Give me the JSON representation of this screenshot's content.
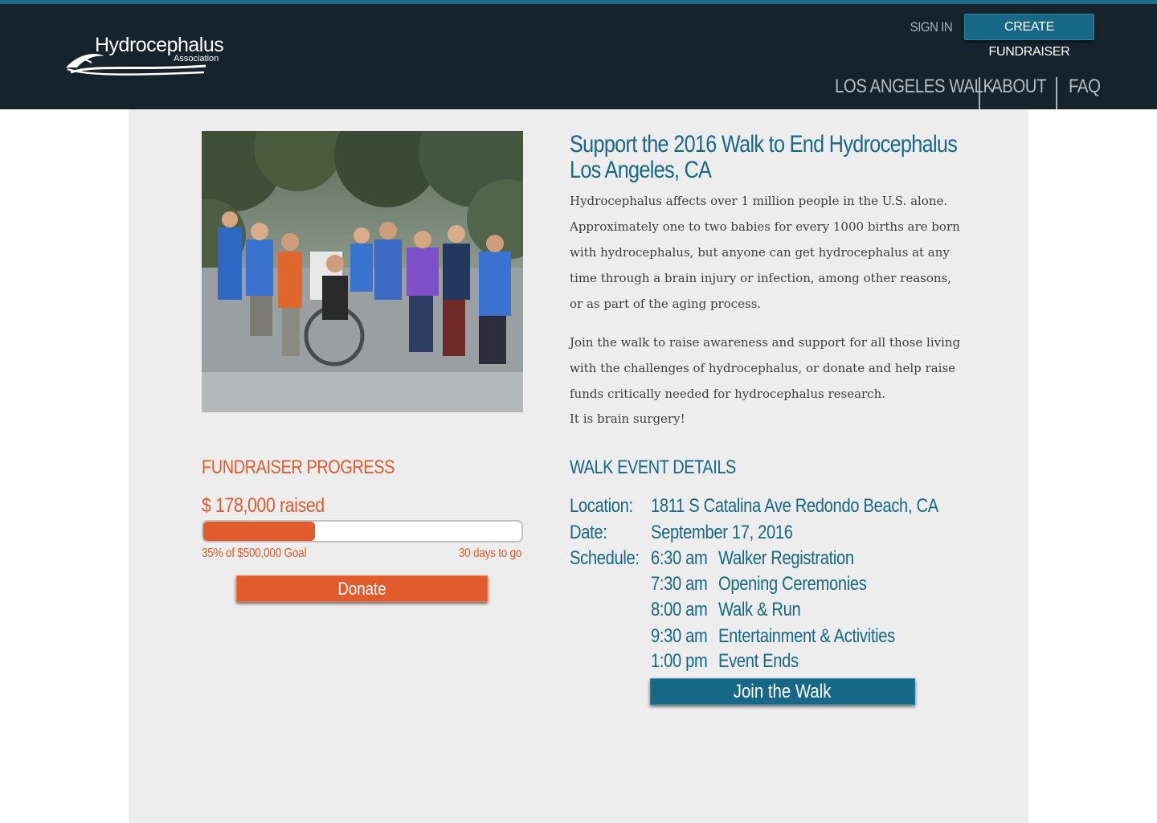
{
  "header": {
    "logo_name": "Hydrocephalus",
    "logo_sub": "Association",
    "sign_in_label": "SIGN IN",
    "create_fundraiser_label": "CREATE FUNDRAISER",
    "nav": [
      {
        "label": "LOS ANGELES WALK"
      },
      {
        "label": "ABOUT"
      },
      {
        "label": "FAQ"
      }
    ],
    "colors": {
      "bar": "#16222c",
      "accent": "#1d6c8c"
    }
  },
  "intro": {
    "headline_lines": [
      "Support the 2016 Walk to End Hydrocephalus",
      "Los Angeles, CA"
    ],
    "paragraph1_lines": [
      "Hydrocephalus affects over 1 million people in the U.S. alone.",
      "Approximately one to two babies for every 1000 births are born",
      "with hydrocephalus, but anyone can get hydrocephalus at any",
      "time through a brain injury or infection, among other reasons,",
      "or as part of the aging process."
    ],
    "paragraph2_lines": [
      "Join the walk to raise awareness and support for all those living",
      "with the challenges of hydrocephalus, or donate and help raise",
      "funds critically needed for hydrocephalus research.",
      "It is brain surgery!"
    ]
  },
  "progress": {
    "heading": "FUNDRAISER PROGRESS",
    "raised_text": "$ 178,000 raised",
    "percent": 35,
    "goal_text": "35% of $500,000 Goal",
    "days_text": "30 days to go",
    "donate_label": "Donate",
    "color": "#e15b2d"
  },
  "event": {
    "heading": "WALK EVENT DETAILS",
    "location_label": "Location:",
    "location_value": "1811 S Catalina Ave Redondo Beach, CA",
    "date_label": "Date:",
    "date_value": "September 17, 2016",
    "schedule_label": "Schedule:",
    "schedule": [
      {
        "time": "6:30 am",
        "activity": "Walker Registration"
      },
      {
        "time": "7:30 am",
        "activity": "Opening Ceremonies"
      },
      {
        "time": "8:00 am",
        "activity": "Walk & Run"
      },
      {
        "time": "9:30 am",
        "activity": "Entertainment & Activities"
      },
      {
        "time": "1:00 pm",
        "activity": "Event Ends"
      }
    ],
    "join_label": "Join the Walk",
    "color": "#176787"
  }
}
